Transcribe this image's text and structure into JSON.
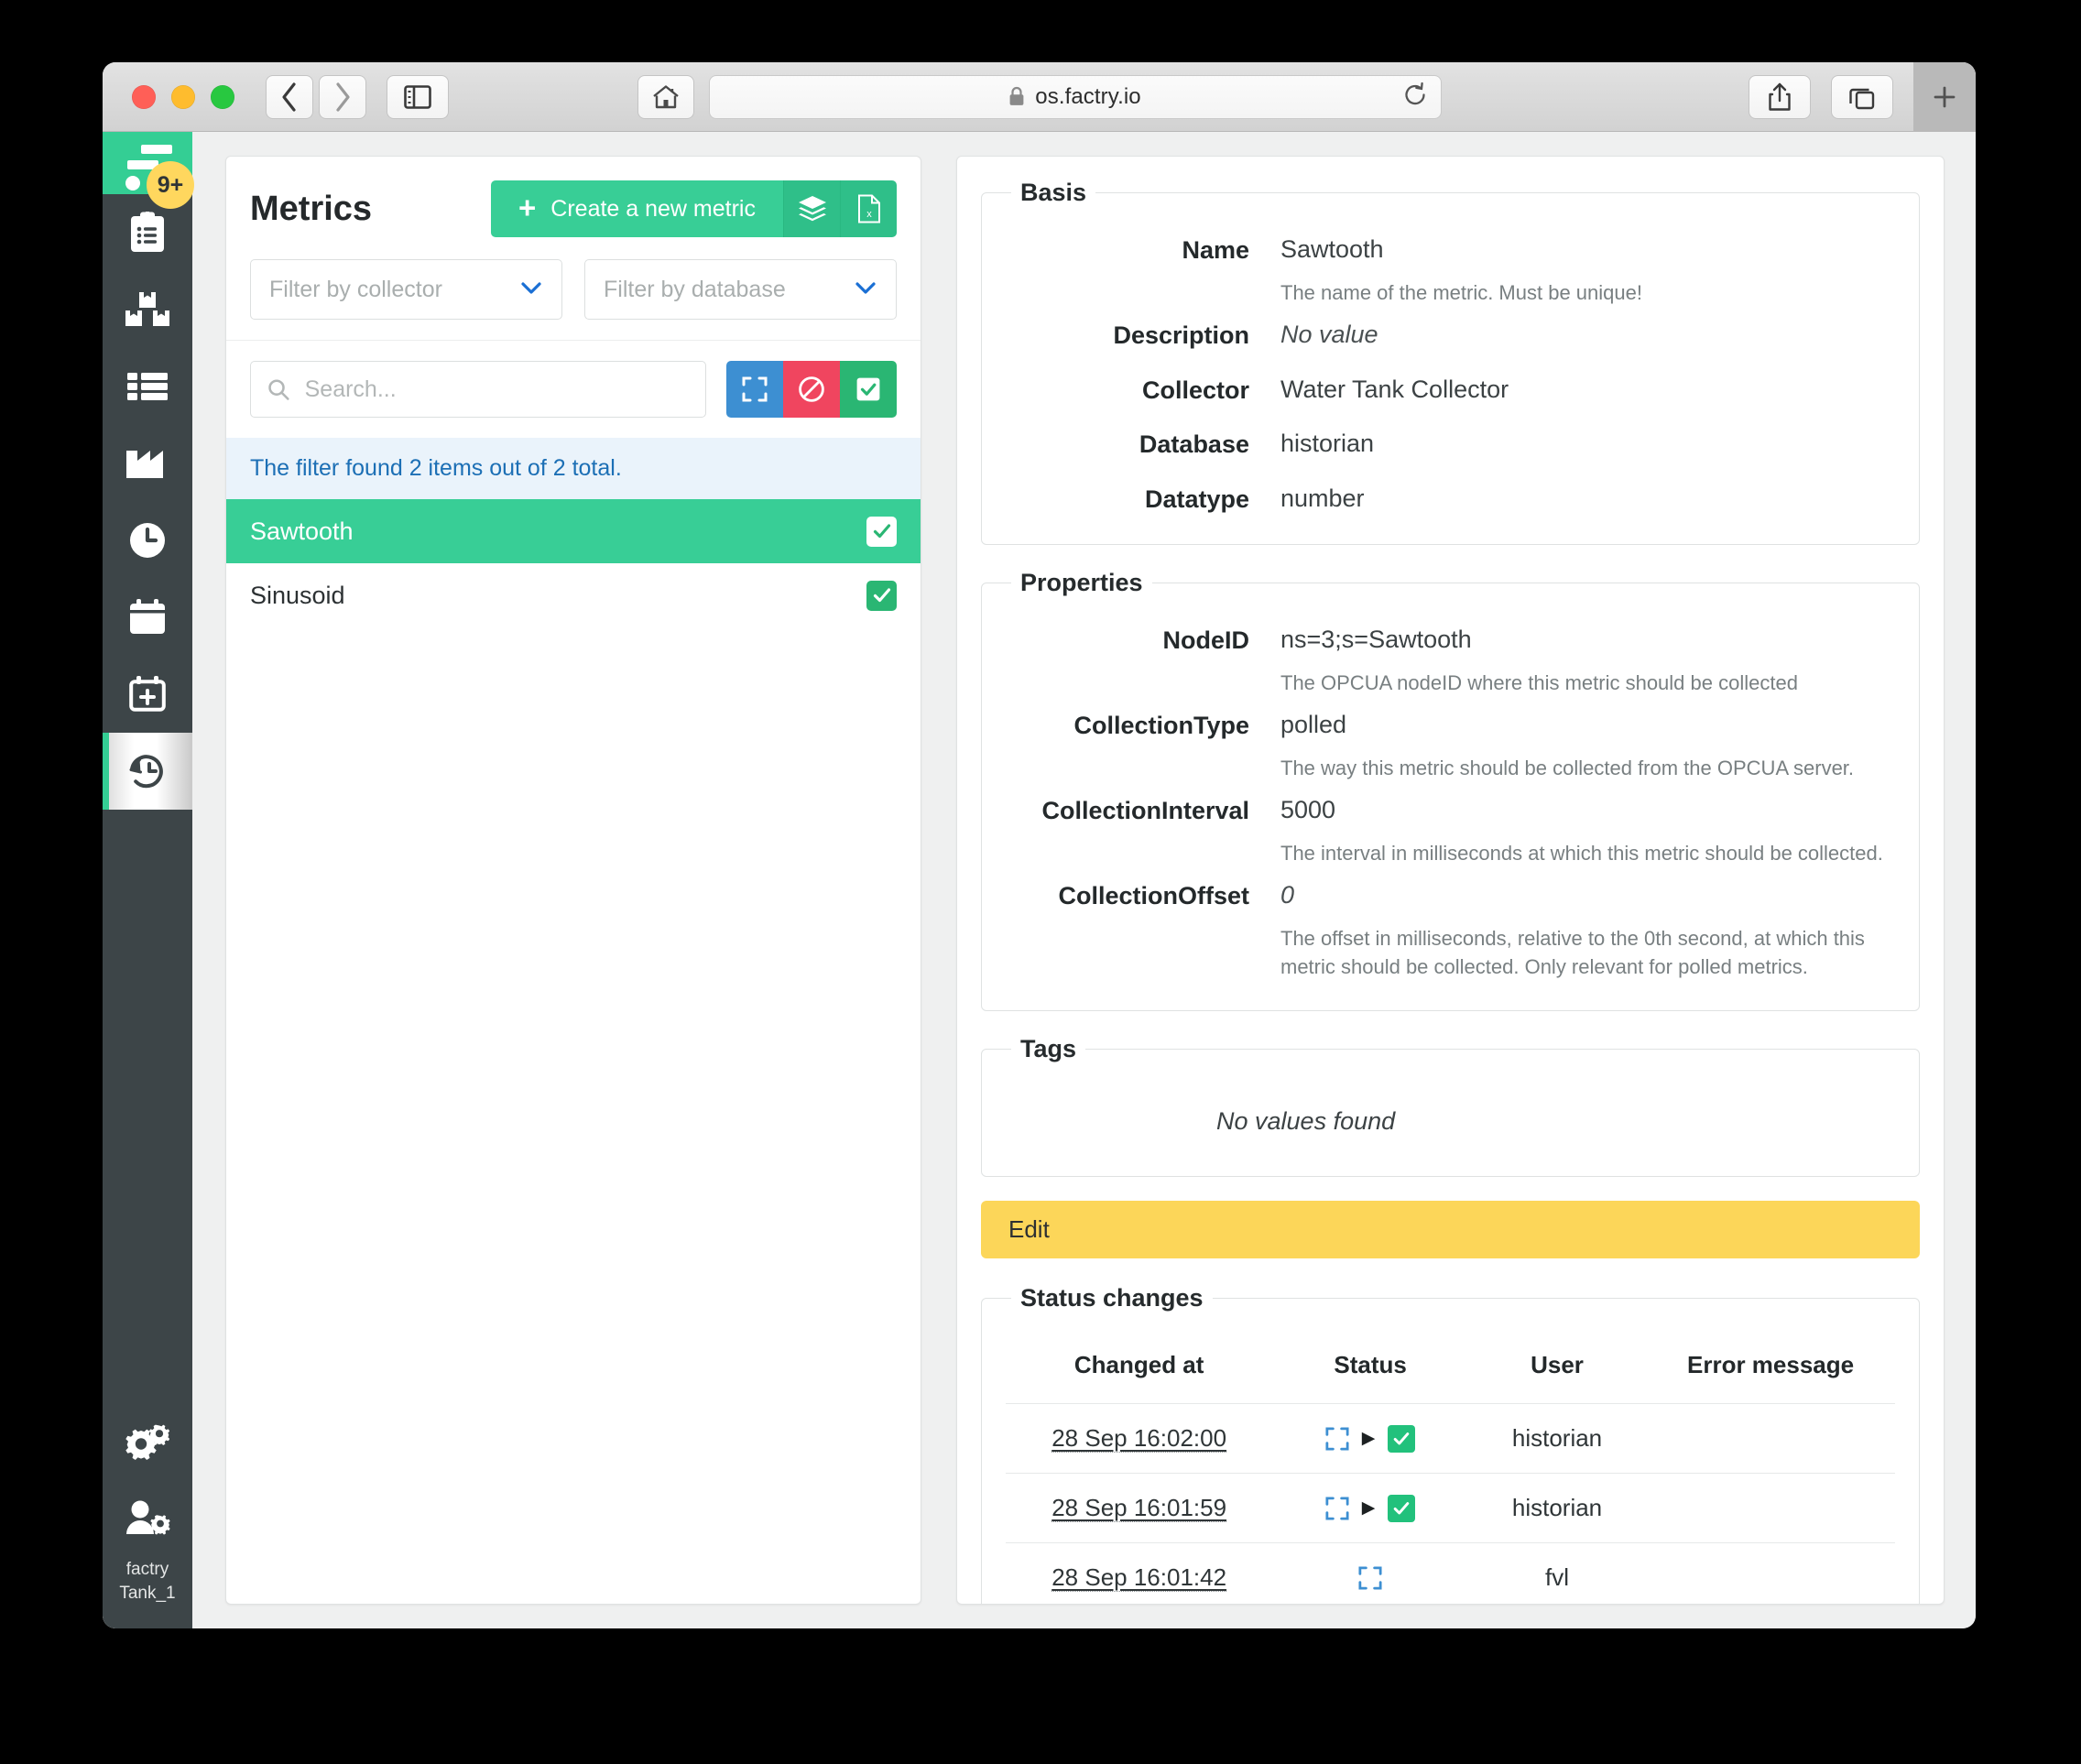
{
  "browser": {
    "url": "os.factry.io",
    "lock_icon": "lock-icon",
    "back_icon": "chevron-left-icon",
    "forward_icon": "chevron-right-icon",
    "sidebar_icon": "sidebar-toggle-icon",
    "home_icon": "home-icon",
    "reload_icon": "reload-icon",
    "share_icon": "share-icon",
    "tabs_icon": "tab-overview-icon",
    "newtab_icon": "plus-icon"
  },
  "sidebar": {
    "brand": {
      "name": "factry-logo",
      "badge": "9+"
    },
    "items": [
      {
        "name": "sidebar-item-tasks",
        "icon": "clipboard-list-icon",
        "active": false
      },
      {
        "name": "sidebar-item-materials",
        "icon": "boxes-icon",
        "active": false
      },
      {
        "name": "sidebar-item-lists",
        "icon": "list-icon",
        "active": false
      },
      {
        "name": "sidebar-item-production",
        "icon": "factory-icon",
        "active": false
      },
      {
        "name": "sidebar-item-shifts",
        "icon": "clock-icon",
        "active": false
      },
      {
        "name": "sidebar-item-calendar",
        "icon": "calendar-icon",
        "active": false
      },
      {
        "name": "sidebar-item-calendar-add",
        "icon": "calendar-plus-icon",
        "active": false
      },
      {
        "name": "sidebar-item-historian",
        "icon": "history-icon",
        "active": true
      }
    ],
    "bottom": [
      {
        "name": "sidebar-item-settings",
        "icon": "gears-icon"
      },
      {
        "name": "sidebar-item-user",
        "icon": "user-gear-icon"
      }
    ],
    "user_org": "factry",
    "user_name": "Tank_1"
  },
  "metrics": {
    "title": "Metrics",
    "create_label": "Create a new metric",
    "create_plus": "+",
    "bulk_icon": "layers-icon",
    "export_icon": "excel-file-icon",
    "collector_filter": "Filter by collector",
    "database_filter": "Filter by database",
    "search_placeholder": "Search...",
    "search_value": "",
    "search_icon": "search-icon",
    "state_buttons": [
      {
        "name": "state-filter-pending",
        "icon": "dashed-square-icon",
        "color": "#3d8fd2"
      },
      {
        "name": "state-filter-disabled",
        "icon": "ban-icon",
        "color": "#f0455f"
      },
      {
        "name": "state-filter-enabled",
        "icon": "check-square-icon",
        "color": "#2ab673"
      }
    ],
    "filter_note": "The filter found 2 items out of 2 total.",
    "items": [
      {
        "label": "Sawtooth",
        "selected": true,
        "status_icon": "check-square-icon"
      },
      {
        "label": "Sinusoid",
        "selected": false,
        "status_icon": "check-square-icon"
      }
    ]
  },
  "detail": {
    "basis": {
      "legend": "Basis",
      "rows": [
        {
          "label": "Name",
          "value": "Sawtooth",
          "help": "The name of the metric. Must be unique!",
          "italic": false
        },
        {
          "label": "Description",
          "value": "No value",
          "help": "",
          "italic": true
        },
        {
          "label": "Collector",
          "value": "Water Tank Collector",
          "help": "",
          "italic": false
        },
        {
          "label": "Database",
          "value": "historian",
          "help": "",
          "italic": false
        },
        {
          "label": "Datatype",
          "value": "number",
          "help": "",
          "italic": false
        }
      ]
    },
    "properties": {
      "legend": "Properties",
      "rows": [
        {
          "label": "NodeID",
          "value": "ns=3;s=Sawtooth",
          "help": "The OPCUA nodeID where this metric should be collected",
          "italic": false
        },
        {
          "label": "CollectionType",
          "value": "polled",
          "help": "The way this metric should be collected from the OPCUA server.",
          "italic": false
        },
        {
          "label": "CollectionInterval",
          "value": "5000",
          "help": "The interval in milliseconds at which this metric should be collected.",
          "italic": false
        },
        {
          "label": "CollectionOffset",
          "value": "0",
          "help": "The offset in milliseconds, relative to the 0th second, at which this metric should be collected. Only relevant for polled metrics.",
          "italic": true
        }
      ]
    },
    "tags": {
      "legend": "Tags",
      "empty_text": "No values found"
    },
    "edit_label": "Edit",
    "status_changes": {
      "legend": "Status changes",
      "columns": [
        "Changed at",
        "Status",
        "User",
        "Error message"
      ],
      "rows": [
        {
          "changed_at": "28 Sep 16:02:00",
          "from_icon": "dashed-square-icon",
          "arrow": "▶",
          "to_icon": "check-square-icon",
          "user": "historian",
          "error": ""
        },
        {
          "changed_at": "28 Sep 16:01:59",
          "from_icon": "dashed-square-icon",
          "arrow": "▶",
          "to_icon": "check-square-icon",
          "user": "historian",
          "error": ""
        },
        {
          "changed_at": "28 Sep 16:01:42",
          "from_icon": "dashed-square-icon",
          "arrow": "",
          "to_icon": "",
          "user": "fvl",
          "error": ""
        }
      ]
    }
  },
  "colors": {
    "brand_green": "#38ce96",
    "sidebar_dark": "#3d4548",
    "badge_yellow": "#ffd75e",
    "edit_yellow": "#fcd659",
    "info_blue": "#1c6fb5",
    "danger_red": "#f0455f",
    "accent_blue": "#3d8fd2"
  }
}
